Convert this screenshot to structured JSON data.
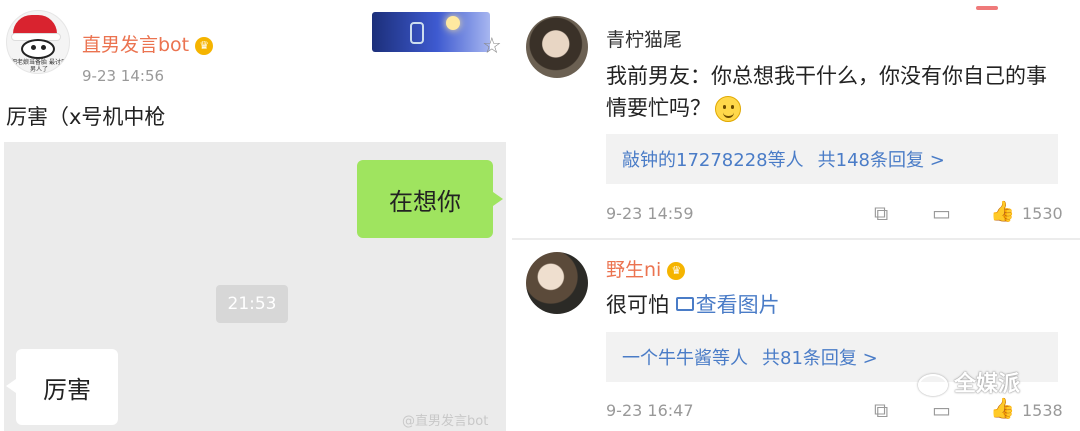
{
  "left_post": {
    "username": "直男发言bot",
    "time": "9-23 14:56",
    "text": "厉害（x号机中枪",
    "avatar_caption": "把老娘当备胎 最讨厌男人了",
    "chat": {
      "sent_message": "在想你",
      "timestamp": "21:53",
      "received_message": "厉害",
      "watermark": "@直男发言bot"
    }
  },
  "comments": [
    {
      "username": "青柠猫尾",
      "text": "我前男友：你总想我干什么，你没有你自己的事情要忙吗？",
      "reply_summary": "敲钟的17278228等人",
      "reply_more": "共148条回复 >",
      "time": "9-23 14:59",
      "likes": "1530"
    },
    {
      "username": "野生ni",
      "text": "很可怕",
      "image_link": "查看图片",
      "reply_summary": "一个牛牛酱等人",
      "reply_more": "共81条回复 >",
      "time": "9-23 16:47",
      "likes": "1538"
    }
  ],
  "watermark_logo": "全媒派",
  "colors": {
    "username_orange": "#eb7350",
    "link_blue": "#4a7cc7",
    "chat_green": "#9fe45f",
    "chat_bg": "#ebebeb"
  },
  "icons": [
    "star-icon",
    "share-icon",
    "comment-icon",
    "like-icon",
    "vip-badge-icon",
    "image-icon",
    "smile-emoji-icon"
  ]
}
